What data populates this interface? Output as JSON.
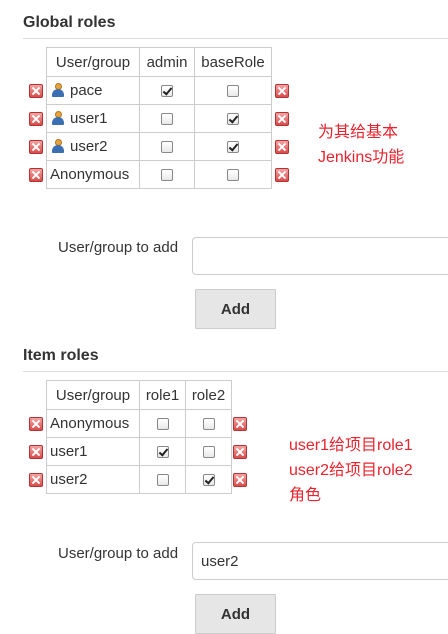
{
  "global_roles": {
    "title": "Global roles",
    "headers": [
      "User/group",
      "admin",
      "baseRole"
    ],
    "rows": [
      {
        "name": "pace",
        "icon": "user-icon",
        "admin": true,
        "baseRole": false
      },
      {
        "name": "user1",
        "icon": "user-icon",
        "admin": false,
        "baseRole": true
      },
      {
        "name": "user2",
        "icon": "user-icon",
        "admin": false,
        "baseRole": true
      },
      {
        "name": "Anonymous",
        "icon": null,
        "admin": false,
        "baseRole": false
      }
    ],
    "add_label": "User/group to add",
    "add_value": "",
    "add_button": "Add",
    "annotation": "为其给基本\nJenkins功能"
  },
  "item_roles": {
    "title": "Item roles",
    "headers": [
      "User/group",
      "role1",
      "role2"
    ],
    "rows": [
      {
        "name": "Anonymous",
        "role1": false,
        "role2": false
      },
      {
        "name": "user1",
        "role1": true,
        "role2": false
      },
      {
        "name": "user2",
        "role1": false,
        "role2": true
      }
    ],
    "add_label": "User/group to add",
    "add_value": "user2",
    "add_button": "Add",
    "annotation": "user1给项目role1\nuser2给项目role2\n角色"
  },
  "colors": {
    "annotation": "#e8242e",
    "delete_icon": "#d94b4b",
    "button_bg": "#e6e6e6"
  }
}
